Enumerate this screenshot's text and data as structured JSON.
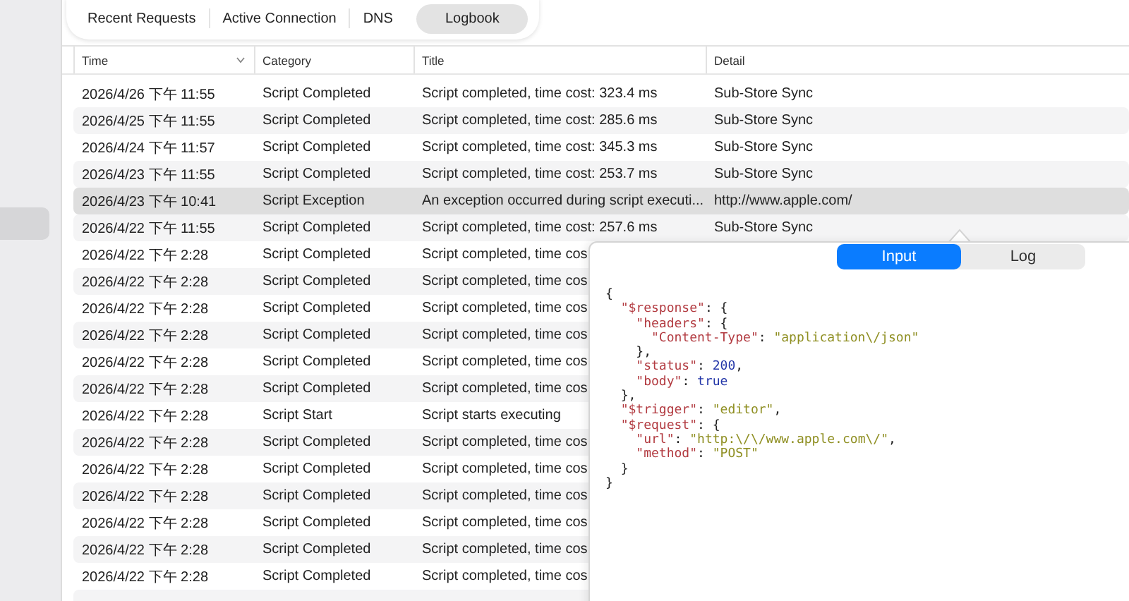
{
  "tabs": [
    {
      "label": "Recent Requests",
      "selected": false
    },
    {
      "label": "Active Connection",
      "selected": false
    },
    {
      "label": "DNS",
      "selected": false
    },
    {
      "label": "Logbook",
      "selected": true
    }
  ],
  "table": {
    "columns": [
      {
        "label": "Time",
        "sorted": true
      },
      {
        "label": "Category",
        "sorted": false
      },
      {
        "label": "Title",
        "sorted": false
      },
      {
        "label": "Detail",
        "sorted": false
      }
    ],
    "rows": [
      {
        "time": "2026/4/26 下午 11:55",
        "category": "Script Completed",
        "title": "Script completed, time cost: 323.4 ms",
        "detail": "Sub-Store Sync",
        "selected": false
      },
      {
        "time": "2026/4/25 下午 11:55",
        "category": "Script Completed",
        "title": "Script completed, time cost: 285.6 ms",
        "detail": "Sub-Store Sync",
        "selected": false
      },
      {
        "time": "2026/4/24 下午 11:57",
        "category": "Script Completed",
        "title": "Script completed, time cost: 345.3 ms",
        "detail": "Sub-Store Sync",
        "selected": false
      },
      {
        "time": "2026/4/23 下午 11:55",
        "category": "Script Completed",
        "title": "Script completed, time cost: 253.7 ms",
        "detail": "Sub-Store Sync",
        "selected": false
      },
      {
        "time": "2026/4/23 下午 10:41",
        "category": "Script Exception",
        "title": "An exception occurred during script executi...",
        "detail": "http://www.apple.com/",
        "selected": true
      },
      {
        "time": "2026/4/22 下午 11:55",
        "category": "Script Completed",
        "title": "Script completed, time cost: 257.6 ms",
        "detail": "Sub-Store Sync",
        "selected": false
      },
      {
        "time": "2026/4/22 下午 2:28",
        "category": "Script Completed",
        "title": "Script completed, time cos",
        "selected": false
      },
      {
        "time": "2026/4/22 下午 2:28",
        "category": "Script Completed",
        "title": "Script completed, time cos",
        "selected": false
      },
      {
        "time": "2026/4/22 下午 2:28",
        "category": "Script Completed",
        "title": "Script completed, time cos",
        "selected": false
      },
      {
        "time": "2026/4/22 下午 2:28",
        "category": "Script Completed",
        "title": "Script completed, time cos",
        "selected": false
      },
      {
        "time": "2026/4/22 下午 2:28",
        "category": "Script Completed",
        "title": "Script completed, time cos",
        "selected": false
      },
      {
        "time": "2026/4/22 下午 2:28",
        "category": "Script Completed",
        "title": "Script completed, time cos",
        "selected": false
      },
      {
        "time": "2026/4/22 下午 2:28",
        "category": "Script Start",
        "title": "Script starts executing",
        "selected": false
      },
      {
        "time": "2026/4/22 下午 2:28",
        "category": "Script Completed",
        "title": "Script completed, time cos",
        "selected": false
      },
      {
        "time": "2026/4/22 下午 2:28",
        "category": "Script Completed",
        "title": "Script completed, time cos",
        "selected": false
      },
      {
        "time": "2026/4/22 下午 2:28",
        "category": "Script Completed",
        "title": "Script completed, time cos",
        "selected": false
      },
      {
        "time": "2026/4/22 下午 2:28",
        "category": "Script Completed",
        "title": "Script completed, time cos",
        "selected": false
      },
      {
        "time": "2026/4/22 下午 2:28",
        "category": "Script Completed",
        "title": "Script completed, time cos",
        "selected": false
      },
      {
        "time": "2026/4/22 下午 2:28",
        "category": "Script Completed",
        "title": "Script completed, time cos",
        "selected": false
      }
    ]
  },
  "popover": {
    "tabs": [
      {
        "label": "Input",
        "selected": true
      },
      {
        "label": "Log",
        "selected": false
      }
    ],
    "code_lines": [
      [
        {
          "kind": "punct",
          "text": "{"
        }
      ],
      [
        {
          "kind": "key",
          "text": "\"$response\""
        },
        {
          "kind": "punct",
          "text": ": {"
        }
      ],
      [
        {
          "kind": "key",
          "text": "\"headers\""
        },
        {
          "kind": "punct",
          "text": ": {"
        }
      ],
      [
        {
          "kind": "key",
          "text": "\"Content-Type\""
        },
        {
          "kind": "punct",
          "text": ": "
        },
        {
          "kind": "string",
          "text": "\"application\\/json\""
        }
      ],
      [
        {
          "kind": "punct",
          "text": "},"
        }
      ],
      [
        {
          "kind": "key",
          "text": "\"status\""
        },
        {
          "kind": "punct",
          "text": ": "
        },
        {
          "kind": "number",
          "text": "200"
        },
        {
          "kind": "punct",
          "text": ","
        }
      ],
      [
        {
          "kind": "key",
          "text": "\"body\""
        },
        {
          "kind": "punct",
          "text": ": "
        },
        {
          "kind": "number",
          "text": "true"
        }
      ],
      [
        {
          "kind": "punct",
          "text": "},"
        }
      ],
      [
        {
          "kind": "key",
          "text": "\"$trigger\""
        },
        {
          "kind": "punct",
          "text": ": "
        },
        {
          "kind": "string",
          "text": "\"editor\""
        },
        {
          "kind": "punct",
          "text": ","
        }
      ],
      [
        {
          "kind": "key",
          "text": "\"$request\""
        },
        {
          "kind": "punct",
          "text": ": {"
        }
      ],
      [
        {
          "kind": "key",
          "text": "\"url\""
        },
        {
          "kind": "punct",
          "text": ": "
        },
        {
          "kind": "string",
          "text": "\"http:\\/\\/www.apple.com\\/\""
        },
        {
          "kind": "punct",
          "text": ","
        }
      ],
      [
        {
          "kind": "key",
          "text": "\"method\""
        },
        {
          "kind": "punct",
          "text": ": "
        },
        {
          "kind": "string",
          "text": "\"POST\""
        }
      ],
      [
        {
          "kind": "punct",
          "text": "}"
        }
      ],
      [
        {
          "kind": "punct",
          "text": "}"
        }
      ]
    ]
  }
}
